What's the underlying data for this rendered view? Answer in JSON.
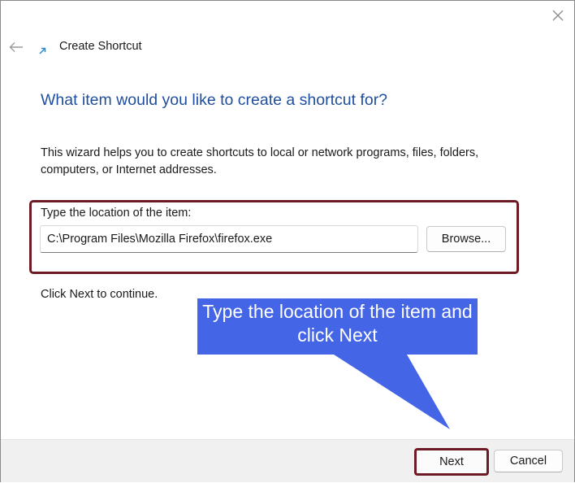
{
  "window": {
    "title": "Create Shortcut",
    "close_icon": "close-icon",
    "back_icon": "back-arrow-icon",
    "shortcut_icon": "shortcut-arrow-icon"
  },
  "main": {
    "heading": "What item would you like to create a shortcut for?",
    "description": "This wizard helps you to create shortcuts to local or network programs, files, folders, computers, or Internet addresses.",
    "location_label": "Type the location of the item:",
    "location_value": "C:\\Program Files\\Mozilla Firefox\\firefox.exe",
    "browse_label": "Browse...",
    "continue_text": "Click Next to continue."
  },
  "callout": {
    "text": "Type the location of the item and click Next",
    "color": "#4466e6"
  },
  "footer": {
    "next_label": "Next",
    "cancel_label": "Cancel"
  },
  "colors": {
    "heading": "#1f4e9e",
    "highlight_border": "#6d1a24"
  }
}
